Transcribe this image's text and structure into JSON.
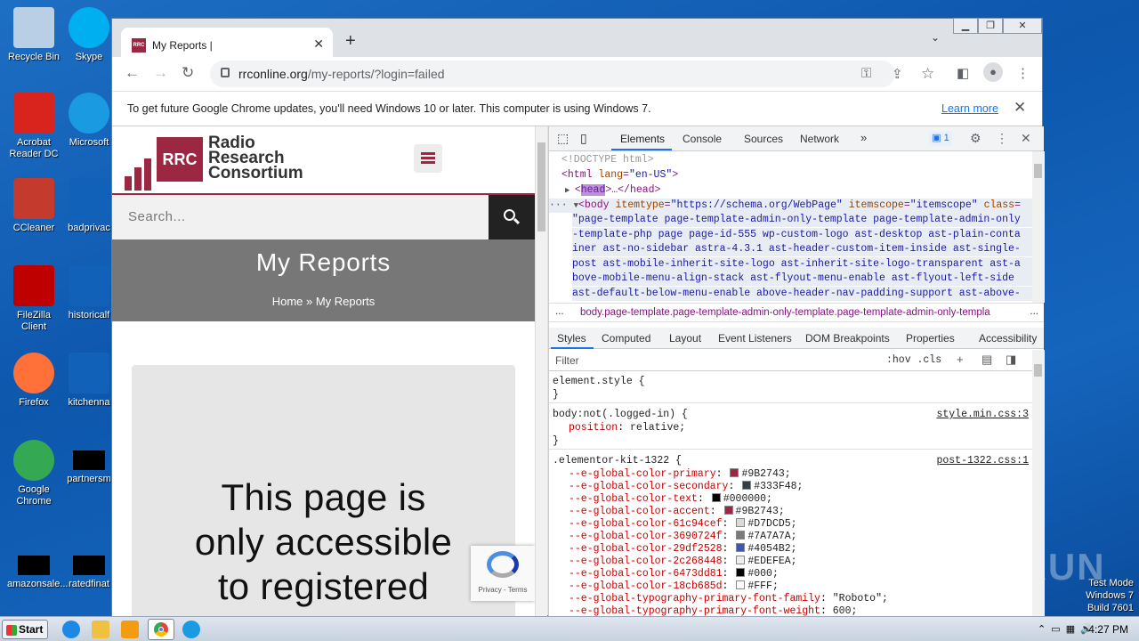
{
  "desktop": {
    "icons": [
      {
        "label": "Recycle Bin",
        "icon": "recycle-bin-icon",
        "color": "#b8cfe6"
      },
      {
        "label": "Skype",
        "icon": "skype-icon",
        "color": "#00aff0"
      },
      {
        "label": "Acrobat Reader DC",
        "icon": "acrobat-icon",
        "color": "#d8241c"
      },
      {
        "label": "Microsoft",
        "icon": "edge-icon",
        "color": "#1a9ae0"
      },
      {
        "label": "CCleaner",
        "icon": "ccleaner-icon",
        "color": "#c43a2d"
      },
      {
        "label": "badprivac",
        "icon": "file-icon",
        "color": "#1261b8"
      },
      {
        "label": "FileZilla Client",
        "icon": "filezilla-icon",
        "color": "#bf0000"
      },
      {
        "label": "historicalf",
        "icon": "file-icon",
        "color": "#1261b8"
      },
      {
        "label": "Firefox",
        "icon": "firefox-icon",
        "color": "#ff7139"
      },
      {
        "label": "kitchenna",
        "icon": "file-icon",
        "color": "#1261b8"
      },
      {
        "label": "Google Chrome",
        "icon": "chrome-icon",
        "color": "#34a853"
      },
      {
        "label": "partnersm",
        "icon": "file-icon",
        "color": "#000000"
      },
      {
        "label": "amazonsale...",
        "icon": "file-icon",
        "color": "#000000"
      },
      {
        "label": "ratedfinat",
        "icon": "file-icon",
        "color": "#000000"
      }
    ]
  },
  "browser": {
    "tab_title": "My Reports |",
    "tab_favicon": "RRC",
    "new_tab": "+",
    "tab_menu": "⌄",
    "url_domain": "rrconline.org",
    "url_path": "/my-reports/?login=failed",
    "infobar_message": "To get future Google Chrome updates, you'll need Windows 10 or later. This computer is using Windows 7.",
    "infobar_link": "Learn more"
  },
  "site": {
    "logo_mark": "RRC",
    "logo_name_1": "Radio",
    "logo_name_2": "Research",
    "logo_name_3": "Consortium",
    "search_placeholder": "Search...",
    "page_title": "My Reports",
    "breadcrumb": "Home » My Reports",
    "notice_1": "This page is",
    "notice_2": "only accessible",
    "notice_3": "to registered",
    "recaptcha": "Privacy - Terms",
    "brand_color": "#9b2743"
  },
  "devtools": {
    "tabs": [
      "Elements",
      "Console",
      "Sources",
      "Network"
    ],
    "more": "»",
    "issues_badge": "1",
    "dom_lines": {
      "l1": "<!DOCTYPE html>",
      "l2_tag": "<html",
      "l2_attr": "lang",
      "l2_val": "\"en-US\"",
      "l2_end": ">",
      "l3_a": "<",
      "l3_head": "head",
      "l3_b": ">…</head>",
      "l4_tag": "<body",
      "l4_a1": "itemtype",
      "l4_v1": "\"https://schema.org/WebPage\"",
      "l4_a2": "itemscope",
      "l4_v2": "\"itemscope\"",
      "l4_a3": "class",
      "l5": "\"page-template page-template-admin-only-template page-template-admin-only",
      "l6": "-template-php page page-id-555 wp-custom-logo ast-desktop ast-plain-conta",
      "l7": "iner ast-no-sidebar astra-4.3.1 ast-header-custom-item-inside ast-single-",
      "l8": "post ast-mobile-inherit-site-logo ast-inherit-site-logo-transparent ast-a",
      "l9": "bove-mobile-menu-align-stack ast-flyout-menu-enable ast-flyout-left-side",
      "l10": "ast-default-below-menu-enable above-header-nav-padding-support ast-above-"
    },
    "crumb_dots": "...",
    "crumb": "body.page-template.page-template-admin-only-template.page-template-admin-only-templa",
    "crumb_right": "...",
    "style_tabs": [
      "Styles",
      "Computed",
      "Layout",
      "Event Listeners",
      "DOM Breakpoints",
      "Properties",
      "Accessibility"
    ],
    "filter_placeholder": "Filter",
    "hov_cls": ":hov .cls",
    "rule1_sel": "element.style {",
    "rule1_end": "}",
    "rule2_sel": "body:not(.logged-in) {",
    "rule2_src": "style.min.css:3",
    "rule2_prop": "position",
    "rule2_val": "relative;",
    "rule2_end": "}",
    "rule3_sel": ".elementor-kit-1322 {",
    "rule3_src": "post-1322.css:1",
    "vars": [
      {
        "name": "--e-global-color-primary",
        "value": "#9B2743;",
        "swatch": "#9B2743"
      },
      {
        "name": "--e-global-color-secondary",
        "value": "#333F48;",
        "swatch": "#333F48"
      },
      {
        "name": "--e-global-color-text",
        "value": "#000000;",
        "swatch": "#000000"
      },
      {
        "name": "--e-global-color-accent",
        "value": "#9B2743;",
        "swatch": "#9B2743"
      },
      {
        "name": "--e-global-color-61c94cef",
        "value": "#D7DCD5;",
        "swatch": "#D7DCD5"
      },
      {
        "name": "--e-global-color-3690724f",
        "value": "#7A7A7A;",
        "swatch": "#7A7A7A"
      },
      {
        "name": "--e-global-color-29df2528",
        "value": "#4054B2;",
        "swatch": "#4054B2"
      },
      {
        "name": "--e-global-color-2c268448",
        "value": "#EDEFEA;",
        "swatch": "#EDEFEA"
      },
      {
        "name": "--e-global-color-6473dd81",
        "value": "#000;",
        "swatch": "#000000"
      },
      {
        "name": "--e-global-color-18cb685d",
        "value": "#FFF;",
        "swatch": "#FFFFFF"
      },
      {
        "name": "--e-global-typography-primary-font-family",
        "value": "\"Roboto\";",
        "swatch": ""
      },
      {
        "name": "--e-global-typography-primary-font-weight",
        "value": "600;",
        "swatch": ""
      }
    ]
  },
  "taskbar": {
    "start": "Start",
    "clock": "4:27 PM"
  },
  "watermark": "ANY RUN",
  "testmode": {
    "l1": "Test Mode",
    "l2": "Windows 7",
    "l3": "Build 7601"
  }
}
